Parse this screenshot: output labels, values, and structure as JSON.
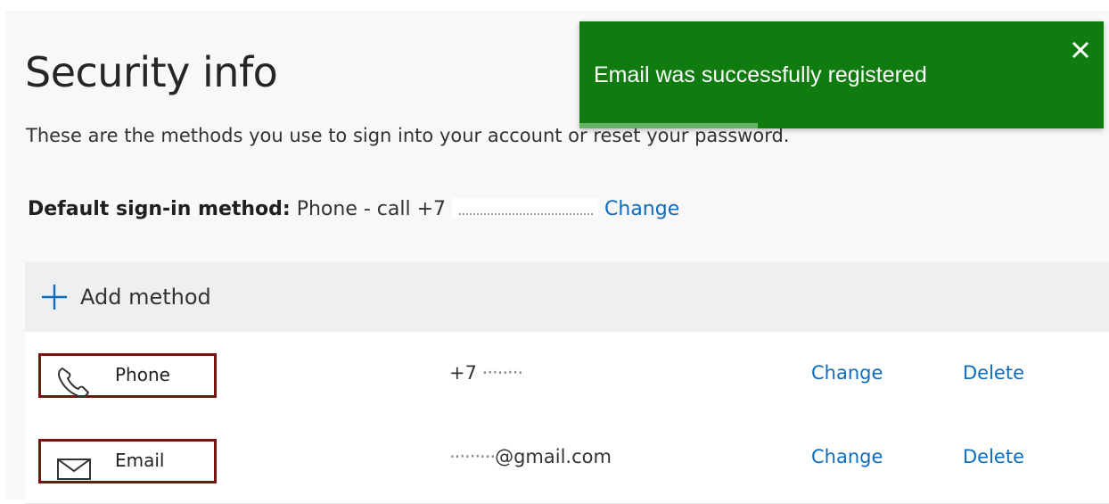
{
  "page": {
    "title": "Security info",
    "subtitle": "These are the methods you use to sign into your account or reset your password.",
    "default_method": {
      "label": "Default sign-in method:",
      "value": "Phone - call +7",
      "change_label": "Change"
    }
  },
  "methods": {
    "add_label": "Add method",
    "items": [
      {
        "icon": "phone-icon",
        "name": "Phone",
        "value_prefix": "+7",
        "value_masked": " ·‧‧··‧‧·",
        "change_label": "Change",
        "delete_label": "Delete"
      },
      {
        "icon": "mail-icon",
        "name": "Email",
        "value_masked": "··‧·‧‧···",
        "value_suffix": "@gmail.com",
        "change_label": "Change",
        "delete_label": "Delete"
      }
    ]
  },
  "toast": {
    "message": "Email was successfully registered",
    "progress": 0.34,
    "color": "#107c10"
  },
  "colors": {
    "link": "#0f6cbd",
    "highlight": "#7b1212"
  }
}
